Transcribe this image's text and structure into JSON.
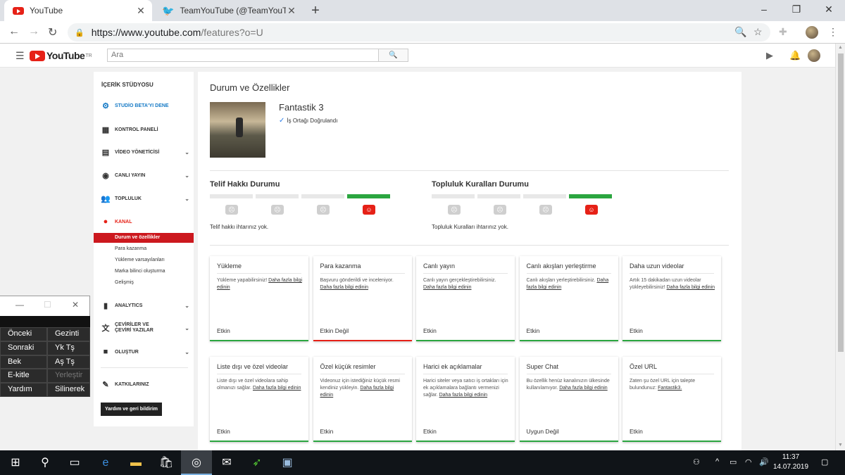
{
  "browser": {
    "tabs": [
      {
        "title": "YouTube",
        "favicon": "youtube-icon"
      },
      {
        "title": "TeamYouTube (@TeamYouTube) |",
        "favicon": "twitter-icon"
      }
    ],
    "url_host": "https://www.youtube.com",
    "url_path": "/features?o=U"
  },
  "youtube": {
    "logo_text": "YouTube",
    "logo_region": "TR",
    "search_placeholder": "Ara"
  },
  "sidebar": {
    "title": "İÇERİK STÜDYOSU",
    "items": [
      {
        "label": "STUDİO BETA'YI DENE",
        "icon": "gear-icon"
      },
      {
        "label": "KONTROL PANELİ",
        "icon": "dashboard-icon"
      },
      {
        "label": "VİDEO YÖNETİCİSİ",
        "icon": "video-manager-icon"
      },
      {
        "label": "CANLI YAYIN",
        "icon": "live-icon"
      },
      {
        "label": "TOPLULUK",
        "icon": "community-icon"
      },
      {
        "label": "KANAL",
        "icon": "channel-icon"
      },
      {
        "label": "ANALYTICS",
        "icon": "analytics-icon"
      },
      {
        "label": "ÇEVİRİLER VE ÇEVİRİ YAZILAR",
        "icon": "translate-icon"
      },
      {
        "label": "OLUŞTUR",
        "icon": "create-icon"
      },
      {
        "label": "KATKILARINIZ",
        "icon": "contributions-icon"
      }
    ],
    "channel_sub": [
      "Durum ve özellikler",
      "Para kazanma",
      "Yükleme varsayılanları",
      "Marka bilinci oluşturma",
      "Gelişmiş"
    ],
    "help_button": "Yardım ve geri bildirim"
  },
  "main": {
    "title": "Durum ve Özellikler",
    "channel_name": "Fantastik 3",
    "verified": "İş Ortağı Doğrulandı",
    "copyright": {
      "title": "Telif Hakkı Durumu",
      "note": "Telif hakkı ihtarınız yok.",
      "level": 4
    },
    "community": {
      "title": "Topluluk Kuralları Durumu",
      "note": "Topluluk Kuralları ihtarınız yok.",
      "level": 4
    },
    "cards": [
      {
        "title": "Yükleme",
        "desc": "Yükleme yapabilirsiniz! ",
        "link": "Daha fazla bilgi edinin",
        "status": "Etkin",
        "ok": true
      },
      {
        "title": "Para kazanma",
        "desc": "Başvuru gönderildi ve inceleniyor. ",
        "link": "Daha fazla bilgi edinin",
        "status": "Etkin Değil",
        "ok": false
      },
      {
        "title": "Canlı yayın",
        "desc": "Canlı yayın gerçekleştirebilirsiniz. ",
        "link": "Daha fazla bilgi edinin",
        "status": "Etkin",
        "ok": true
      },
      {
        "title": "Canlı akışları yerleştirme",
        "desc": "Canlı akışları yerleştirebilirsiniz. ",
        "link": "Daha fazla bilgi edinin",
        "status": "Etkin",
        "ok": true
      },
      {
        "title": "Daha uzun videolar",
        "desc": "Artık 15 dakikadan uzun videolar yükleyebilirsiniz! ",
        "link": "Daha fazla bilgi edinin",
        "status": "Etkin",
        "ok": true
      },
      {
        "title": "Liste dışı ve özel videolar",
        "desc": "Liste dışı ve özel videolara sahip olmanızı sağlar. ",
        "link": "Daha fazla bilgi edinin",
        "status": "Etkin",
        "ok": true
      },
      {
        "title": "Özel küçük resimler",
        "desc": "Videonuz için istediğiniz küçük resmi kendiniz yükleyin. ",
        "link": "Daha fazla bilgi edinin",
        "status": "Etkin",
        "ok": true
      },
      {
        "title": "Harici ek açıklamalar",
        "desc": "Harici siteler veya satıcı iş ortakları için ek açıklamalara bağlantı vermenizi sağlar. ",
        "link": "Daha fazla bilgi edinin",
        "status": "Etkin",
        "ok": true
      },
      {
        "title": "Super Chat",
        "desc": "Bu özellik henüz kanalınızın ülkesinde kullanılamıyor. ",
        "link": "Daha fazla bilgi edinin",
        "status": "Uygun Değil",
        "ok": true
      },
      {
        "title": "Özel URL",
        "desc": "Zaten şu özel URL için talepte bulundunuz: ",
        "link": "Fantastik3.",
        "status": "Etkin",
        "ok": true
      }
    ]
  },
  "floating_window": {
    "buttons": [
      [
        "Önceki",
        "Gezinti"
      ],
      [
        "Sonraki",
        "Yk Tş"
      ],
      [
        "Bek",
        "Aş Tş"
      ],
      [
        "E-kitle",
        "Yerleştir"
      ],
      [
        "Yardım",
        "Silinerek"
      ]
    ]
  },
  "taskbar": {
    "time": "11:37",
    "date": "14.07.2019"
  }
}
